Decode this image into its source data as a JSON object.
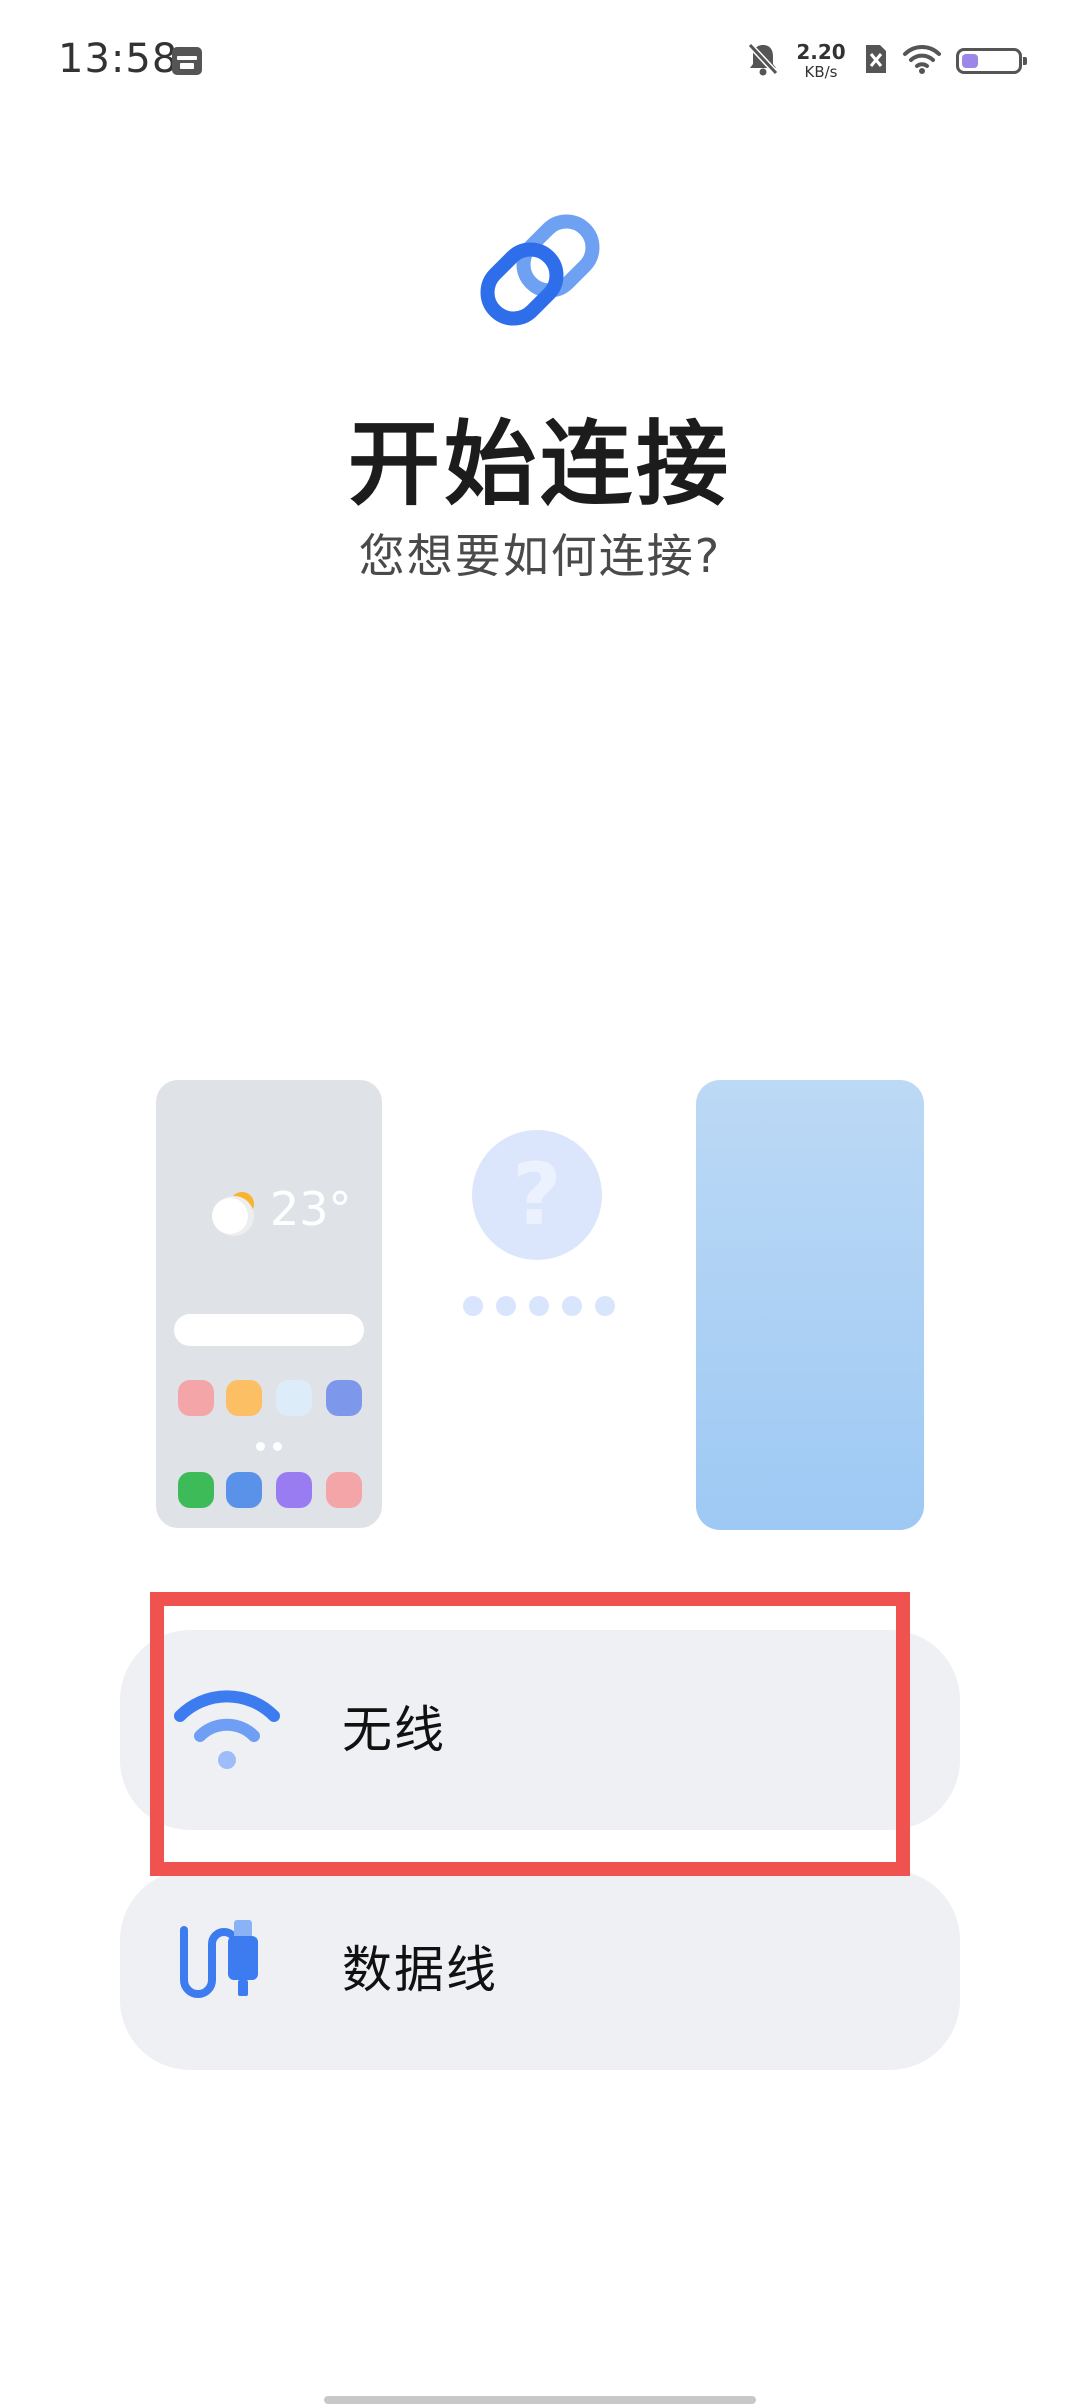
{
  "status_bar": {
    "time": "13:58",
    "net_speed_value": "2.20",
    "net_speed_unit": "KB/s",
    "battery_level": 0.3,
    "icons": [
      "calendar-icon",
      "silent-bell-icon",
      "sim-off-icon",
      "wifi-icon",
      "battery-icon"
    ]
  },
  "header": {
    "icon": "link-icon",
    "title": "开始连接",
    "subtitle": "您想要如何连接?"
  },
  "illustration": {
    "weather_temp": "23°",
    "question_mark": "?",
    "colors": {
      "phone_left_bg": "#dfe3e8",
      "phone_right_top": "#bcd9f5",
      "phone_right_bottom": "#9ec9f4",
      "app_red": "#f4a5a8",
      "app_orange": "#fdbf63",
      "app_lightblue": "#dcecf8",
      "app_blue": "#7d98ea",
      "app_green": "#3dbb58",
      "app_mid_blue": "#5a92ea",
      "app_purple": "#9a7cf2"
    }
  },
  "options": [
    {
      "label": "无线",
      "icon": "wifi-icon"
    },
    {
      "label": "数据线",
      "icon": "usb-cable-icon"
    }
  ],
  "accent_color": "#3d7bf0",
  "highlight_color": "#f05250"
}
